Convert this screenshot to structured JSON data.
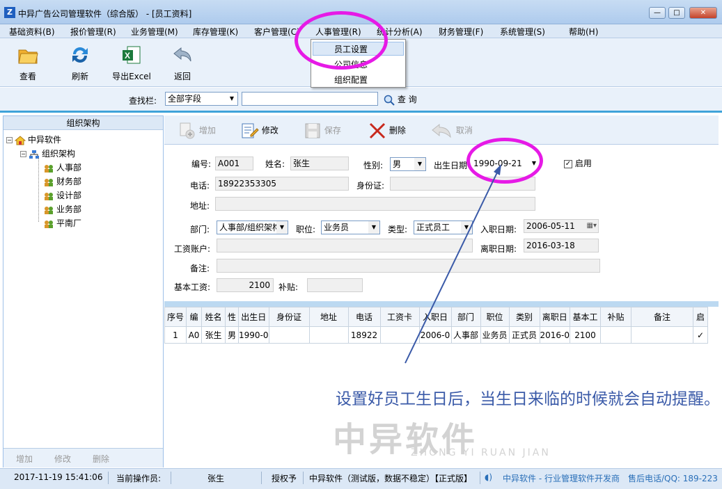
{
  "window": {
    "title": "中异广告公司管理软件（综合版） - [员工资料]",
    "minimize": "—",
    "maximize": "□",
    "close": "✕"
  },
  "menu": [
    "基础资料(B)",
    "报价管理(R)",
    "业务管理(M)",
    "库存管理(K)",
    "客户管理(C)",
    "人事管理(R)",
    "统计分析(A)",
    "财务管理(F)",
    "系统管理(S)",
    "帮助(H)"
  ],
  "dropdown": [
    "员工设置",
    "公司信息",
    "组织配置"
  ],
  "toolbar": {
    "view": "查看",
    "refresh": "刷新",
    "export": "导出Excel",
    "back": "返回"
  },
  "search": {
    "label": "查找栏:",
    "field": "全部字段",
    "value": "",
    "button": "查 询"
  },
  "tree": {
    "header": "组织架构",
    "root": "中异软件",
    "org": "组织架构",
    "depts": [
      "人事部",
      "财务部",
      "设计部",
      "业务部",
      "平南厂"
    ]
  },
  "left_footer": {
    "add": "增加",
    "edit": "修改",
    "delete": "删除"
  },
  "actions": {
    "add": "增加",
    "edit": "修改",
    "save": "保存",
    "delete": "删除",
    "cancel": "取消"
  },
  "form": {
    "id_label": "编号:",
    "id": "A001",
    "name_label": "姓名:",
    "name": "张生",
    "gender_label": "性别:",
    "gender": "男",
    "birth_label": "出生日期",
    "birth": "1990-09-21",
    "enable_label": "启用",
    "phone_label": "电话:",
    "phone": "18922353305",
    "idcard_label": "身份证:",
    "idcard": "",
    "address_label": "地址:",
    "address": "",
    "dept_label": "部门:",
    "dept": "人事部/组织架构",
    "position_label": "职位:",
    "position": "业务员",
    "type_label": "类型:",
    "type": "正式员工",
    "hire_label": "入职日期:",
    "hire": "2006-05-11",
    "account_label": "工资账户:",
    "account": "",
    "leave_label": "离职日期:",
    "leave": "2016-03-18",
    "remark_label": "备注:",
    "remark": "",
    "salary_label": "基本工资:",
    "salary": "2100",
    "allowance_label": "补贴:",
    "allowance": ""
  },
  "grid": {
    "columns": [
      "序号",
      "编",
      "姓名",
      "性",
      "出生日",
      "身份证",
      "地址",
      "电话",
      "工资卡",
      "入职日",
      "部门",
      "职位",
      "类别",
      "离职日",
      "基本工",
      "补贴",
      "备注",
      "启"
    ],
    "rows": [
      [
        "1",
        "A0",
        "张生",
        "男",
        "1990-0",
        "",
        "",
        "18922",
        "",
        "2006-0",
        "人事部",
        "业务员",
        "正式员",
        "2016-0",
        "2100",
        "",
        "",
        "✓"
      ]
    ]
  },
  "annotation": "设置好员工生日后，当生日来临的时候就会自动提醒。",
  "watermark": {
    "main": "中异软件",
    "sub": "ZHONG YI RUAN JIAN"
  },
  "status": {
    "datetime": "2017-11-19 15:41:06",
    "operator_label": "当前操作员:",
    "operator": "张生",
    "license_label": "授权予",
    "license": "中异软件（测试版，数据不稳定）【正式版】",
    "vendor": "中异软件 - 行业管理软件开发商",
    "hotline": "售后电话/QQ: 189-223"
  },
  "colors": {
    "accent": "#3fa3d9",
    "annotation": "#e61ae6",
    "note": "#3a5aa8"
  }
}
